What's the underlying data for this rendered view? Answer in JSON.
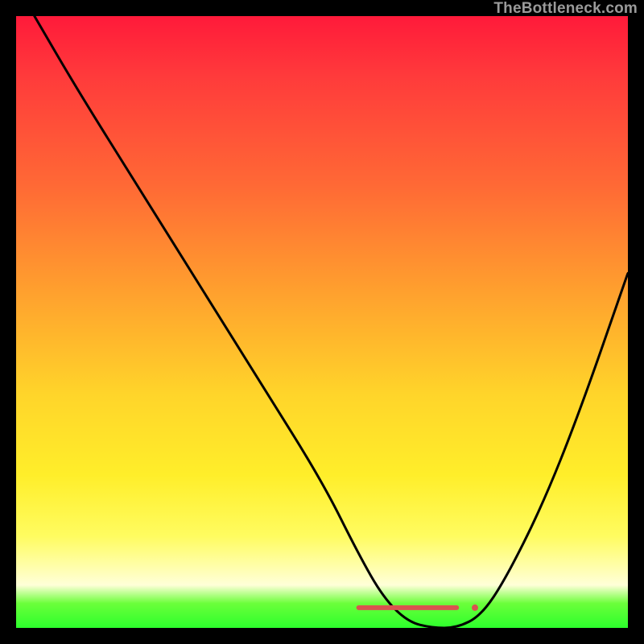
{
  "watermark": "TheBottleneck.com",
  "chart_data": {
    "type": "line",
    "title": "",
    "xlabel": "",
    "ylabel": "",
    "xlim": [
      0,
      100
    ],
    "ylim": [
      0,
      100
    ],
    "grid": false,
    "legend": false,
    "series": [
      {
        "name": "bottleneck-curve",
        "x": [
          3,
          10,
          20,
          30,
          40,
          50,
          56,
          60,
          64,
          68,
          72,
          76,
          80,
          86,
          92,
          100
        ],
        "y": [
          100,
          88,
          72,
          56,
          40,
          24,
          12,
          5,
          1,
          0,
          0,
          2,
          8,
          20,
          35,
          58
        ]
      }
    ],
    "markers": [
      {
        "name": "red-segment",
        "kind": "segment",
        "x": [
          56,
          72
        ],
        "y": [
          3.3,
          3.3
        ],
        "color": "#d9534f",
        "width": 6
      },
      {
        "name": "red-dot",
        "kind": "dot",
        "x": 75,
        "y": 3.3,
        "color": "#d9534f",
        "radius": 4
      }
    ],
    "background_gradient": {
      "direction": "vertical",
      "stops": [
        {
          "pos": 0.0,
          "color": "#ff1a3a"
        },
        {
          "pos": 0.1,
          "color": "#ff3b3b"
        },
        {
          "pos": 0.28,
          "color": "#ff6a35"
        },
        {
          "pos": 0.45,
          "color": "#ffa02e"
        },
        {
          "pos": 0.62,
          "color": "#ffd52a"
        },
        {
          "pos": 0.75,
          "color": "#ffee2a"
        },
        {
          "pos": 0.85,
          "color": "#fffc60"
        },
        {
          "pos": 0.93,
          "color": "#ffffd8"
        },
        {
          "pos": 0.96,
          "color": "#6bff3a"
        },
        {
          "pos": 1.0,
          "color": "#2cff2c"
        }
      ]
    }
  }
}
